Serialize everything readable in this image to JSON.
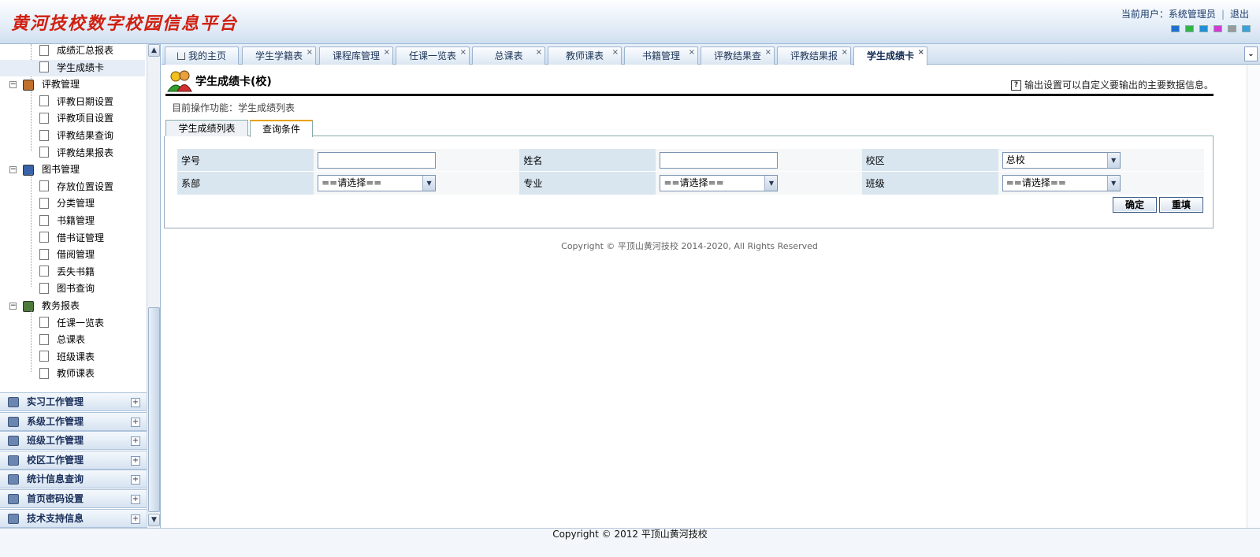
{
  "header": {
    "app_title": "黄河技校数字校园信息平台",
    "current_user_label": "当前用户：系统管理员",
    "logout": "退出",
    "themes": [
      "#1f6fd0",
      "#33b54a",
      "#1f8fd8",
      "#d43ad4",
      "#9a9a9a",
      "#3aa0e0"
    ]
  },
  "sidebar": {
    "tree_top": [
      {
        "label": "成绩汇总报表"
      },
      {
        "label": "学生成绩卡",
        "selected": true
      }
    ],
    "groups": [
      {
        "label": "评教管理",
        "icon": "evaluation-icon",
        "items": [
          "评教日期设置",
          "评教项目设置",
          "评教结果查询",
          "评教结果报表"
        ]
      },
      {
        "label": "图书管理",
        "icon": "book-icon",
        "items": [
          "存放位置设置",
          "分类管理",
          "书籍管理",
          "借书证管理",
          "借阅管理",
          "丢失书籍",
          "图书查询"
        ]
      },
      {
        "label": "教务报表",
        "icon": "report-chart-icon",
        "items": [
          "任课一览表",
          "总课表",
          "班级课表",
          "教师课表"
        ]
      }
    ],
    "accordions": [
      "实习工作管理",
      "系级工作管理",
      "班级工作管理",
      "校区工作管理",
      "统计信息查询",
      "首页密码设置",
      "技术支持信息"
    ]
  },
  "tabs": [
    {
      "label": "我的主页",
      "home": true
    },
    {
      "label": "学生学籍表"
    },
    {
      "label": "课程库管理"
    },
    {
      "label": "任课一览表"
    },
    {
      "label": "总课表"
    },
    {
      "label": "教师课表"
    },
    {
      "label": "书籍管理"
    },
    {
      "label": "评教结果查"
    },
    {
      "label": "评教结果报"
    },
    {
      "label": "学生成绩卡",
      "active": true
    }
  ],
  "page": {
    "title": "学生成绩卡(校)",
    "hint": "输出设置可以自定义要输出的主要数据信息。",
    "breadcrumb": "目前操作功能：学生成绩列表",
    "subtabs": [
      "学生成绩列表",
      "查询条件"
    ]
  },
  "form": {
    "student_id_label": "学号",
    "student_id_value": "",
    "name_label": "姓名",
    "name_value": "",
    "campus_label": "校区",
    "campus_value": "总校",
    "department_label": "系部",
    "department_value": "==请选择==",
    "major_label": "专业",
    "major_value": "==请选择==",
    "class_label": "班级",
    "class_value": "==请选择==",
    "confirm": "确定",
    "reset": "重填"
  },
  "content_copyright": "Copyright © 平顶山黄河技校 2014-2020, All Rights Reserved",
  "footer": "Copyright © 2012 平顶山黄河技校"
}
